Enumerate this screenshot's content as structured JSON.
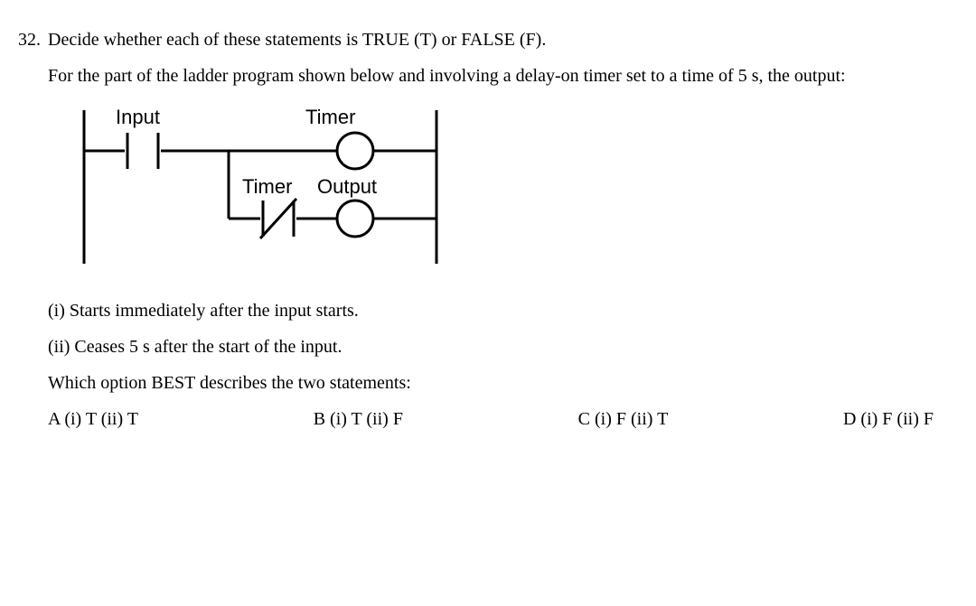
{
  "question": {
    "number": "32.",
    "prompt": "Decide whether each of these statements is TRUE (T) or FALSE (F).",
    "context": "For the part of the ladder program shown below and involving a delay-on timer set to a time of 5 s, the output:",
    "diagram": {
      "input_label": "Input",
      "timer_label": "Timer",
      "timer_contact_label": "Timer",
      "output_label": "Output"
    },
    "statements": {
      "s1": "(i) Starts immediately after the input starts.",
      "s2": "(ii) Ceases 5 s after the start of the input."
    },
    "which": "Which option BEST describes the two statements:",
    "options": {
      "a": "A (i) T (ii) T",
      "b": "B (i) T (ii) F",
      "c": "C (i) F (ii) T",
      "d": "D (i) F (ii) F"
    }
  }
}
